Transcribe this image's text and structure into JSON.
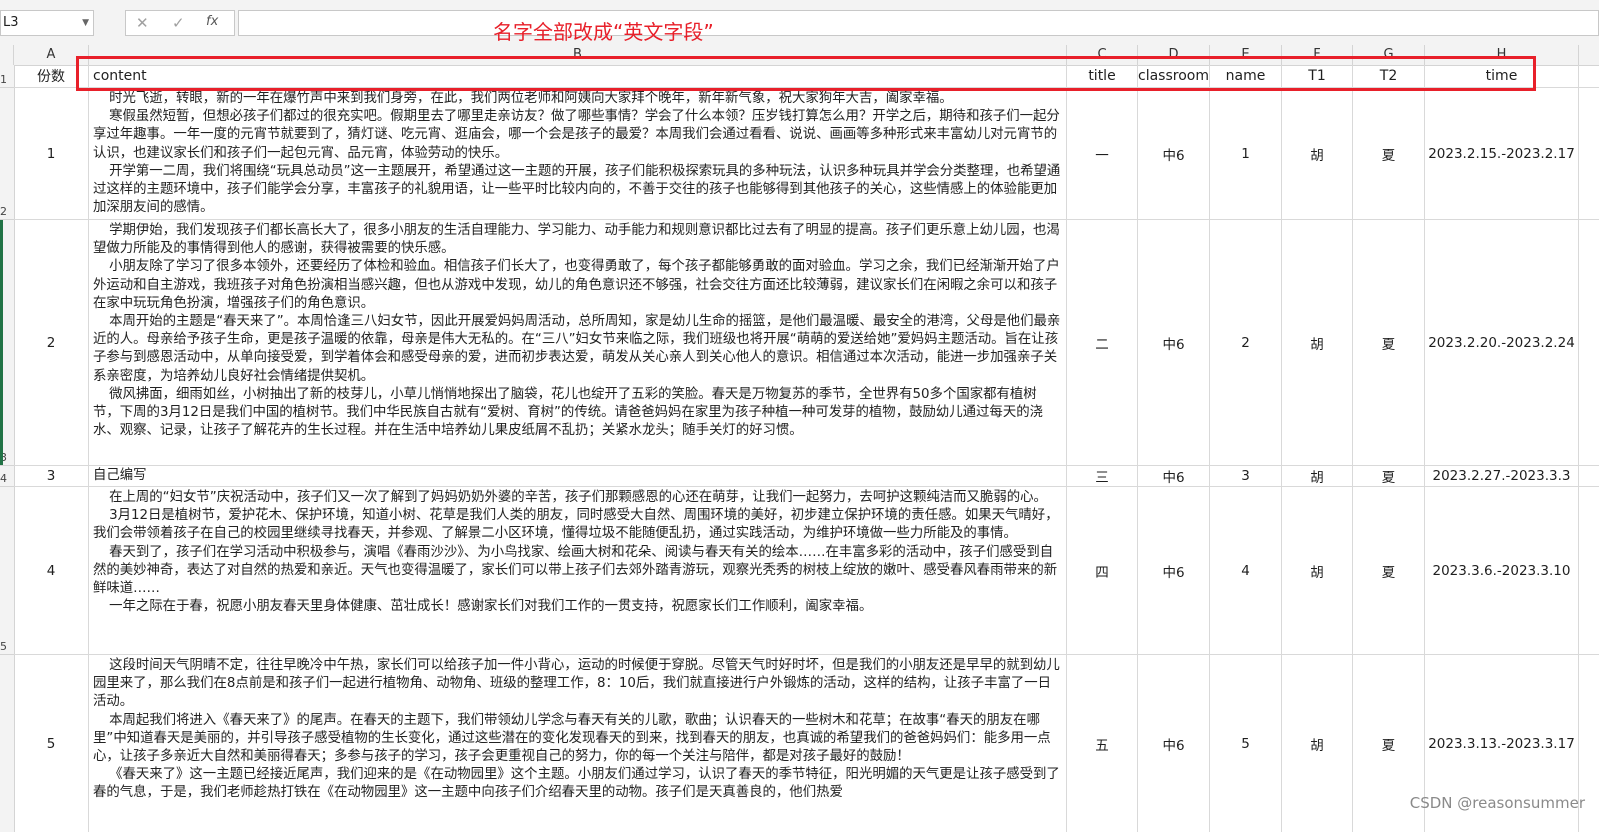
{
  "formula_bar": {
    "name_box": "L3",
    "cancel_icon": "✕",
    "enter_icon": "✓",
    "fx_icon": "fx",
    "value": ""
  },
  "annotation": "名字全部改成“英文字段”",
  "columns": [
    "A",
    "B",
    "C",
    "D",
    "E",
    "F",
    "G",
    "H"
  ],
  "row_numbers": [
    "1",
    "2",
    "3",
    "4",
    "5"
  ],
  "header_row": {
    "A": "份数",
    "B": "content",
    "C": "title",
    "D": "classroom",
    "E": "name",
    "F": "T1",
    "G": "T2",
    "H": "time"
  },
  "rows": [
    {
      "A": "1",
      "B": [
        "时光飞逝，转眼，新的一年在爆竹声中来到我们身旁，在此，我们两位老师和阿姨向大家拜个晚年，新年新气象，祝大家狗年大吉，阖家幸福。",
        "寒假虽然短暂，但想必孩子们都过的很充实吧。假期里去了哪里走亲访友？做了哪些事情？学会了什么本领？压岁钱打算怎么用？开学之后，期待和孩子们一起分享过年趣事。一年一度的元宵节就要到了，猜灯谜、吃元宵、逛庙会，哪一个会是孩子的最爱？本周我们会通过看看、说说、画画等多种形式来丰富幼儿对元宵节的认识，也建议家长们和孩子们一起包元宵、品元宵，体验劳动的快乐。",
        "开学第一二周，我们将围绕“玩具总动员”这一主题展开，希望通过这一主题的开展，孩子们能积极探索玩具的多种玩法，认识多种玩具并学会分类整理，也希望通过这样的主题环境中，孩子们能学会分享，丰富孩子的礼貌用语，让一些平时比较内向的，不善于交往的孩子也能够得到其他孩子的关心，这些情感上的体验能更加加深朋友间的感情。"
      ],
      "C": "一",
      "D": "中6",
      "E": "1",
      "F": "胡",
      "G": "夏",
      "H": "2023.2.15.-2023.2.17"
    },
    {
      "A": "2",
      "B": [
        "学期伊始，我们发现孩子们都长高长大了，很多小朋友的生活自理能力、学习能力、动手能力和规则意识都比过去有了明显的提高。孩子们更乐意上幼儿园，也渴望做力所能及的事情得到他人的感谢，获得被需要的快乐感。",
        "小朋友除了学习了很多本领外，还要经历了体检和验血。相信孩子们长大了，也变得勇敢了，每个孩子都能够勇敢的面对验血。学习之余，我们已经渐渐开始了户外运动和自主游戏，我班孩子对角色扮演相当感兴趣，但也从游戏中发现，幼儿的角色意识还不够强，社会交往方面还比较薄弱，建议家长们在闲暇之余可以和孩子在家中玩玩角色扮演，增强孩子们的角色意识。",
        "本周开始的主题是“春天来了”。本周恰逢三八妇女节，因此开展爱妈妈周活动，总所周知，家是幼儿生命的摇篮，是他们最温暖、最安全的港湾，父母是他们最亲近的人。母亲给予孩子生命，更是孩子温暖的依靠，母亲是伟大无私的。在“三八”妇女节来临之际，我们班级也将开展“萌萌的爱送给她”爱妈妈主题活动。旨在让孩子参与到感恩活动中，从单向接受爱，到学着体会和感受母亲的爱，进而初步表达爱，萌发从关心亲人到关心他人的意识。相信通过本次活动，能进一步加强亲子关系亲密度，为培养幼儿良好社会情绪提供契机。",
        "微风拂面，细雨如丝，小树抽出了新的枝芽儿，小草儿悄悄地探出了脑袋，花儿也绽开了五彩的笑脸。春天是万物复苏的季节，全世界有50多个国家都有植树节，下周的3月12日是我们中国的植树节。我们中华民族自古就有“爱树、育树”的传统。请爸爸妈妈在家里为孩子种植一种可发芽的植物，鼓励幼儿通过每天的浇水、观察、记录，让孩子了解花卉的生长过程。并在生活中培养幼儿果皮纸屑不乱扔；关紧水龙头；随手关灯的好习惯。"
      ],
      "C": "二",
      "D": "中6",
      "E": "2",
      "F": "胡",
      "G": "夏",
      "H": "2023.2.20.-2023.2.24"
    },
    {
      "A": "3",
      "B": [
        "自己编写"
      ],
      "C": "三",
      "D": "中6",
      "E": "3",
      "F": "胡",
      "G": "夏",
      "H": "2023.2.27.-2023.3.3"
    },
    {
      "A": "4",
      "B": [
        "在上周的“妇女节”庆祝活动中，孩子们又一次了解到了妈妈奶奶外婆的辛苦，孩子们那颗感恩的心还在萌芽，让我们一起努力，去呵护这颗纯洁而又脆弱的心。",
        "3月12日是植树节，爱护花木、保护环境，知道小树、花草是我们人类的朋友，同时感受大自然、周围环境的美好，初步建立保护环境的责任感。如果天气晴好，我们会带领着孩子在自己的校园里继续寻找春天，并参观、了解景二小区环境，懂得垃圾不能随便乱扔，通过实践活动，为维护环境做一些力所能及的事情。",
        "春天到了，孩子们在学习活动中积极参与，演唱《春雨沙沙》、为小鸟找家、绘画大树和花朵、阅读与春天有关的绘本……在丰富多彩的活动中，孩子们感受到自然的美妙神奇，表达了对自然的热爱和亲近。天气也变得温暖了，家长们可以带上孩子们去郊外踏青游玩，观察光秃秀的树枝上绽放的嫩叶、感受春风春雨带来的新鲜味道……",
        "一年之际在于春，祝愿小朋友春天里身体健康、茁壮成长！感谢家长们对我们工作的一贯支持，祝愿家长们工作顺利，阖家幸福。"
      ],
      "C": "四",
      "D": "中6",
      "E": "4",
      "F": "胡",
      "G": "夏",
      "H": "2023.3.6.-2023.3.10"
    },
    {
      "A": "5",
      "B": [
        "这段时间天气阴晴不定，往往早晚冷中午热，家长们可以给孩子加一件小背心，运动的时候便于穿脱。尽管天气时好时坏，但是我们的小朋友还是早早的就到幼儿园里来了，那么我们在8点前是和孩子们一起进行植物角、动物角、班级的整理工作，8：10后，我们就直接进行户外锻炼的活动，这样的结构，让孩子丰富了一日活动。",
        "本周起我们将进入《春天来了》的尾声。在春天的主题下，我们带领幼儿学念与春天有关的儿歌，歌曲；认识春天的一些树木和花草；在故事“春天的朋友在哪里”中知道春天是美丽的，并引导孩子感受植物的生长变化，通过这些潜在的变化发现春天的到来，找到春天的朋友，也真诚的希望我们的爸爸妈妈们：能多用一点心，让孩子多亲近大自然和美丽得春天；多参与孩子的学习，孩子会更重视自己的努力，你的每一个关注与陪伴，都是对孩子最好的鼓励！",
        "《春天来了》这一主题已经接近尾声，我们迎来的是《在动物园里》这个主题。小朋友们通过学习，认识了春天的季节特征，阳光明媚的天气更是让孩子感受到了春的气息，于是，我们老师趁热打铁在《在动物园里》这一主题中向孩子们介绍春天里的动物。孩子们是天真善良的，他们热爱"
      ],
      "C": "五",
      "D": "中6",
      "E": "5",
      "F": "胡",
      "G": "夏",
      "H": "2023.3.13.-2023.3.17"
    }
  ],
  "watermark": "CSDN @reasonsummer"
}
